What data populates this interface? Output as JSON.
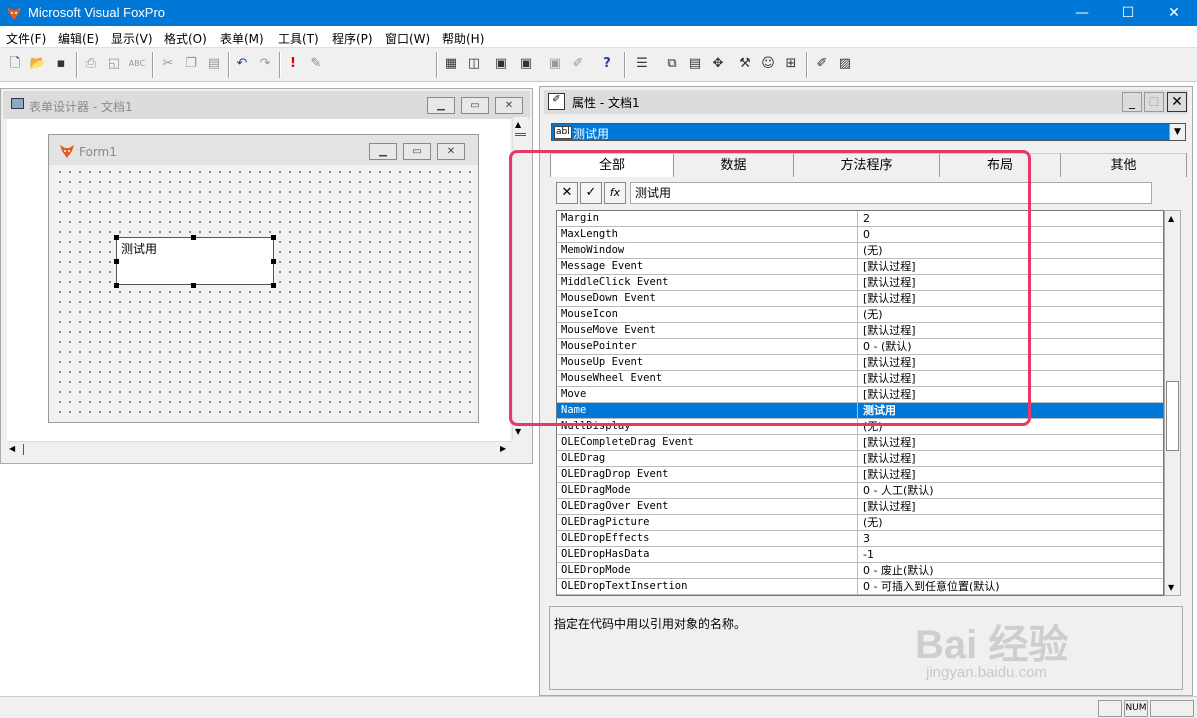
{
  "app": {
    "title": "Microsoft Visual FoxPro"
  },
  "window_controls": {
    "minimize": "—",
    "maximize": "☐",
    "close": "✕"
  },
  "menu": [
    "文件(F)",
    "编辑(E)",
    "显示(V)",
    "格式(O)",
    "表单(M)",
    "工具(T)",
    "程序(P)",
    "窗口(W)",
    "帮助(H)"
  ],
  "toolbar": {
    "icons": [
      "new-icon",
      "open-icon",
      "save-icon",
      "print-icon",
      "print-preview-icon",
      "spell-check-icon",
      "cut-icon",
      "copy-icon",
      "paste-icon",
      "undo-icon",
      "redo-icon",
      "run-icon",
      "modify-form-icon",
      "database-icon",
      "report-icon",
      "form-wizard-icon",
      "report-wizard-icon",
      "wizard-icon",
      "builder-icon",
      "help-icon",
      "form-control-toolbar-icon",
      "data-environment-icon",
      "properties-icon",
      "code-icon",
      "color-palette-icon",
      "layout-icon",
      "form-builder-icon",
      "autoformat-icon",
      "build-icon",
      "tools-icon"
    ],
    "combo_value": ""
  },
  "designer": {
    "title": "表单设计器 - 文档1",
    "form_title": "Form1",
    "textbox_text": "测试用"
  },
  "properties": {
    "title": "属性 - 文档1",
    "object_selector": "测试用",
    "object_badge": "abl",
    "tabs": [
      "全部",
      "数据",
      "方法程序",
      "布局",
      "其他"
    ],
    "active_tab": "全部",
    "edit_buttons": {
      "cancel": "✕",
      "accept": "✓",
      "fx": "fx"
    },
    "edit_value": "测试用",
    "rows": [
      {
        "name": "Margin",
        "value": "2"
      },
      {
        "name": "MaxLength",
        "value": "0"
      },
      {
        "name": "MemoWindow",
        "value": "(无)"
      },
      {
        "name": "Message Event",
        "value": "[默认过程]"
      },
      {
        "name": "MiddleClick Event",
        "value": "[默认过程]"
      },
      {
        "name": "MouseDown Event",
        "value": "[默认过程]"
      },
      {
        "name": "MouseIcon",
        "value": "(无)"
      },
      {
        "name": "MouseMove Event",
        "value": "[默认过程]"
      },
      {
        "name": "MousePointer",
        "value": "0 - (默认)"
      },
      {
        "name": "MouseUp Event",
        "value": "[默认过程]"
      },
      {
        "name": "MouseWheel Event",
        "value": "[默认过程]"
      },
      {
        "name": "Move",
        "value": "[默认过程]"
      },
      {
        "name": "Name",
        "value": "测试用",
        "selected": true
      },
      {
        "name": "NullDisplay",
        "value": "(无)"
      },
      {
        "name": "OLECompleteDrag Event",
        "value": "[默认过程]"
      },
      {
        "name": "OLEDrag",
        "value": "[默认过程]"
      },
      {
        "name": "OLEDragDrop Event",
        "value": "[默认过程]"
      },
      {
        "name": "OLEDragMode",
        "value": "0 - 人工(默认)"
      },
      {
        "name": "OLEDragOver Event",
        "value": "[默认过程]"
      },
      {
        "name": "OLEDragPicture",
        "value": "(无)"
      },
      {
        "name": "OLEDropEffects",
        "value": "3"
      },
      {
        "name": "OLEDropHasData",
        "value": "-1"
      },
      {
        "name": "OLEDropMode",
        "value": "0 - 废止(默认)"
      },
      {
        "name": "OLEDropTextInsertion",
        "value": "0 - 可插入到任意位置(默认)"
      }
    ],
    "description": "指定在代码中用以引用对象的名称。"
  },
  "statusbar": {
    "num": "NUM"
  },
  "watermark": {
    "brand": "Bai 经验",
    "url": "jingyan.baidu.com"
  },
  "colors": {
    "titlebar": "#0078d7",
    "selection": "#0078d7",
    "highlight": "#e8386a"
  }
}
